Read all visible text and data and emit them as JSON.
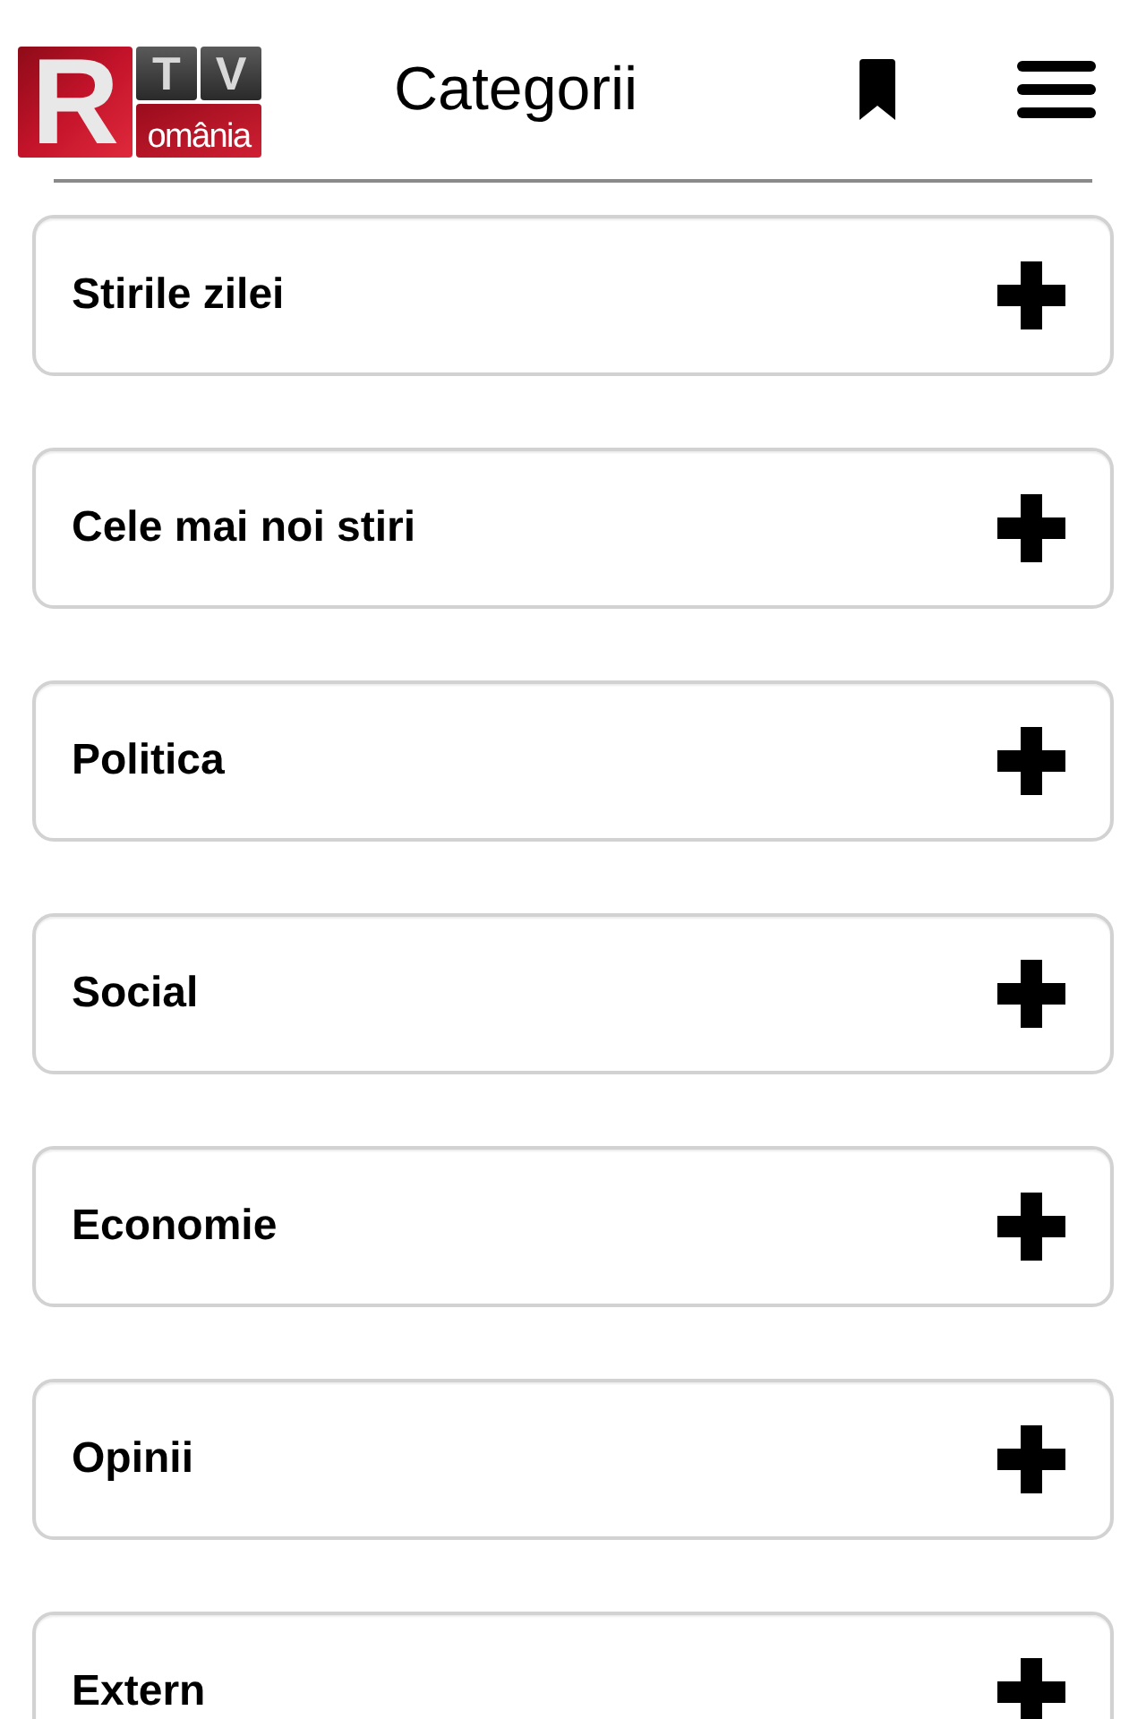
{
  "header": {
    "logo": {
      "letter": "R",
      "tiles": [
        "T",
        "V"
      ],
      "word": "omânia"
    },
    "title": "Categorii"
  },
  "categories": [
    {
      "label": "Stirile zilei",
      "expanded": false
    },
    {
      "label": "Cele mai noi stiri",
      "expanded": false
    },
    {
      "label": "Politica",
      "expanded": false
    },
    {
      "label": "Social",
      "expanded": false
    },
    {
      "label": "Economie",
      "expanded": false
    },
    {
      "label": "Opinii",
      "expanded": false
    },
    {
      "label": "Extern",
      "expanded": false
    }
  ]
}
